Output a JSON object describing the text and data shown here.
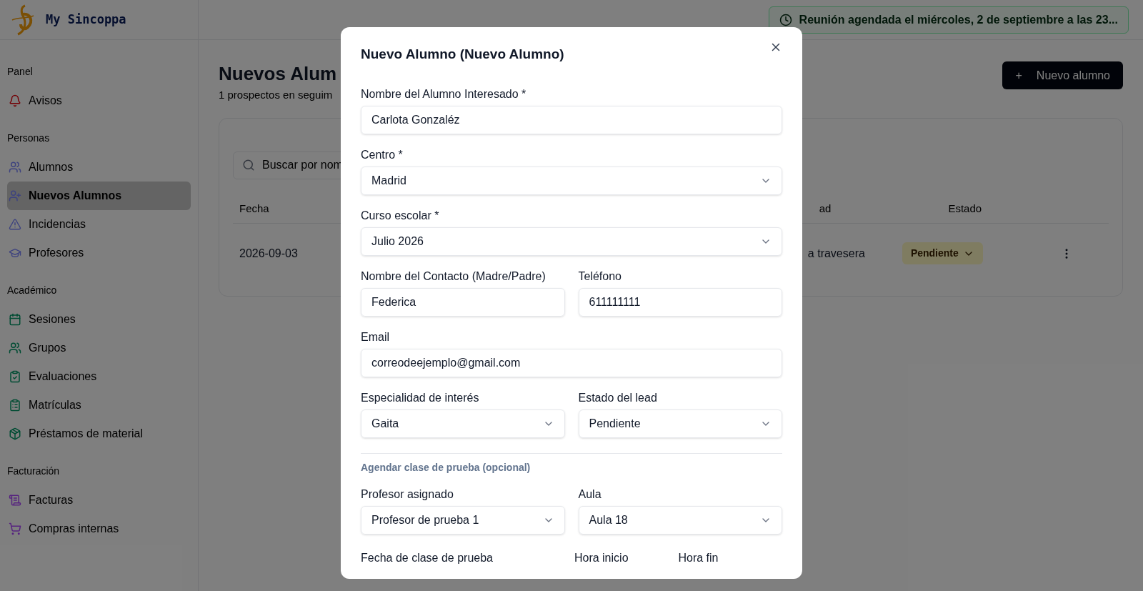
{
  "brand": {
    "name": "My Sincoppa"
  },
  "sidebar": {
    "sections": [
      {
        "title": "Panel",
        "items": [
          {
            "label": "Avisos",
            "selected": false
          }
        ]
      },
      {
        "title": "Personas",
        "items": [
          {
            "label": "Alumnos",
            "selected": false
          },
          {
            "label": "Nuevos Alumnos",
            "selected": true
          },
          {
            "label": "Incidencias",
            "selected": false
          },
          {
            "label": "Profesores",
            "selected": false
          }
        ]
      },
      {
        "title": "Académico",
        "items": [
          {
            "label": "Sesiones",
            "selected": false
          },
          {
            "label": "Grupos",
            "selected": false
          },
          {
            "label": "Evaluaciones",
            "selected": false
          },
          {
            "label": "Matrículas",
            "selected": false
          },
          {
            "label": "Préstamos de material",
            "selected": false
          }
        ]
      },
      {
        "title": "Facturación",
        "items": [
          {
            "label": "Facturas",
            "selected": false
          },
          {
            "label": "Compras internas",
            "selected": false
          }
        ]
      }
    ]
  },
  "banner": {
    "text": "Reunión agendada el miércoles, 2 de septiembre a las 23..."
  },
  "page": {
    "title": "Nuevos Alum",
    "subtitle": "1 prospectos en seguim",
    "new_button": {
      "icon": "+",
      "label": "Nuevo alumno"
    }
  },
  "search": {
    "placeholder": "Buscar por nom"
  },
  "table": {
    "columns": [
      "Fecha",
      "ad",
      "Estado"
    ],
    "rows": [
      {
        "date": "2026-09-03",
        "column_2": "a travesera",
        "status": "Pendiente"
      }
    ]
  },
  "modal": {
    "title": "Nuevo Alumno (Nuevo Alumno)",
    "rows": [
      {
        "kind": "fields",
        "fields": [
          {
            "kind": "text",
            "label": "Nombre del Alumno Interesado *",
            "value": "Carlota Gonzaléz"
          }
        ]
      },
      {
        "kind": "fields",
        "fields": [
          {
            "kind": "select",
            "label": "Centro *",
            "value": "Madrid"
          }
        ]
      },
      {
        "kind": "fields",
        "fields": [
          {
            "kind": "select",
            "label": "Curso escolar *",
            "value": "Julio 2026"
          }
        ]
      },
      {
        "kind": "fields",
        "fields": [
          {
            "kind": "text",
            "label": "Nombre del Contacto (Madre/Padre)",
            "value": "Federica"
          },
          {
            "kind": "text",
            "label": "Teléfono",
            "value": "611111111"
          }
        ]
      },
      {
        "kind": "fields",
        "fields": [
          {
            "kind": "text",
            "label": "Email",
            "value": "correodeejemplo@gmail.com"
          }
        ]
      },
      {
        "kind": "fields",
        "fields": [
          {
            "kind": "select",
            "label": "Especialidad de interés",
            "value": "Gaita"
          },
          {
            "kind": "select",
            "label": "Estado del lead",
            "value": "Pendiente"
          }
        ]
      },
      {
        "kind": "heading",
        "text": "Agendar clase de prueba (opcional)"
      },
      {
        "kind": "fields",
        "fields": [
          {
            "kind": "select",
            "label": "Profesor asignado",
            "value": "Profesor de prueba 1"
          },
          {
            "kind": "select",
            "label": "Aula",
            "value": "Aula 18"
          }
        ]
      },
      {
        "kind": "labels",
        "fields": [
          {
            "kind": "label",
            "label": "Fecha de clase de prueba"
          },
          {
            "kind": "label",
            "label": "Hora inicio"
          },
          {
            "kind": "label",
            "label": "Hora fin"
          }
        ]
      }
    ]
  }
}
